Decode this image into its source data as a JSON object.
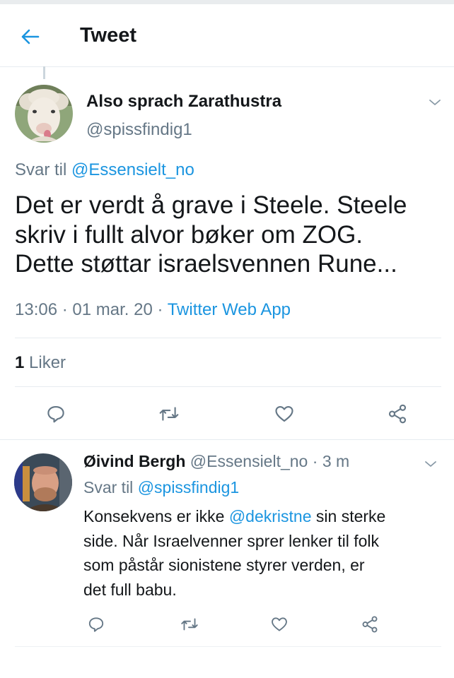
{
  "header": {
    "title": "Tweet"
  },
  "main_tweet": {
    "author_name": "Also sprach Zarathustra",
    "handle": "@spissfindig1",
    "reply_prefix": "Svar til",
    "reply_handle": "@Essensielt_no",
    "text_lines": [
      "Det er verdt å grave i Steele. Steele",
      "skriv i fullt alvor bøker om ZOG.",
      "Dette støttar israelsvennen Rune..."
    ],
    "time": "13:06",
    "separator": "·",
    "date": "01 mar. 20",
    "source": "Twitter Web App",
    "likes_count": "1",
    "likes_label": "Liker"
  },
  "reply_tweet": {
    "author_name": "Øivind Bergh",
    "handle": "@Essensielt_no",
    "separator": "·",
    "time_ago": "3 m",
    "reply_prefix": "Svar til",
    "reply_handle": "@spissfindig1",
    "text_line1_before": "Konsekvens er ikke ",
    "text_line1_mention": "@dekristne",
    "text_line1_after": " sin sterke",
    "text_lines_rest": [
      "side. Når Israelvenner sprer lenker til folk",
      "som påstår sionistene styrer verden, er",
      "det full babu."
    ]
  },
  "icons": {
    "back": "arrow-left-icon",
    "caret": "chevron-down-icon",
    "reply": "comment-icon",
    "retweet": "retweet-icon",
    "like": "heart-icon",
    "share": "share-icon"
  },
  "colors": {
    "accent": "#1b95e0",
    "muted": "#657786",
    "text": "#14171a",
    "divider": "#e6ecf0"
  }
}
